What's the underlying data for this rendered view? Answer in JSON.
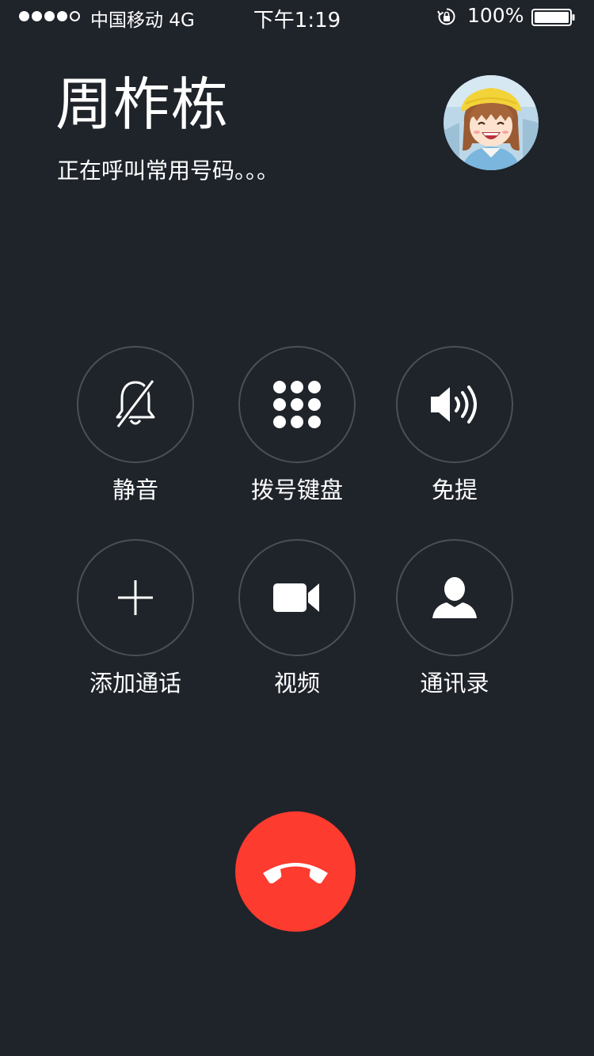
{
  "status_bar": {
    "carrier": "中国移动 4G",
    "time": "下午1:19",
    "battery": "100%",
    "signal_bars_filled": 4,
    "signal_bars_total": 5,
    "rotation_lock_icon": "rotation-lock-icon",
    "battery_icon": "battery-icon"
  },
  "call": {
    "contact_name": "周柞栋",
    "status": "正在呼叫常用号码。。。",
    "avatar_icon": "avatar-cartoon-girl"
  },
  "controls": [
    {
      "label": "静音",
      "icon": "mute-bell-icon"
    },
    {
      "label": "拨号键盘",
      "icon": "keypad-icon"
    },
    {
      "label": "免提",
      "icon": "speaker-icon"
    },
    {
      "label": "添加通话",
      "icon": "add-call-icon"
    },
    {
      "label": "视频",
      "icon": "video-camera-icon"
    },
    {
      "label": "通讯录",
      "icon": "contacts-icon"
    }
  ],
  "end_call": {
    "icon": "hang-up-icon",
    "color": "#fd3b2f"
  },
  "colors": {
    "background": "#1f232a",
    "button_ring": "#4a5057",
    "text": "#ffffff"
  }
}
